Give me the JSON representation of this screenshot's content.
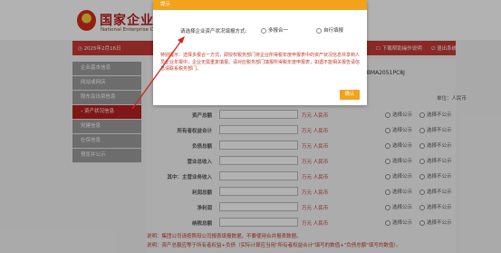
{
  "header": {
    "brand_cn": "国家企业信",
    "brand_en": "National Enterprise Cr"
  },
  "topbar": {
    "date": "2025年2月16日",
    "help": "下载帮助操作说明",
    "logout": "退出系统"
  },
  "sidebar": {
    "items": [
      {
        "label": "企业基本信息",
        "active": false
      },
      {
        "label": "网站或网店",
        "active": false
      },
      {
        "label": "股东及出资信息",
        "active": false
      },
      {
        "label": "资产状况信息",
        "active": true
      },
      {
        "label": "党建信息",
        "active": false
      },
      {
        "label": "社保信息",
        "active": false
      },
      {
        "label": "预览并公示",
        "active": false
      }
    ]
  },
  "main": {
    "reg_code": "1BMA2051PC8J",
    "unit_label": "单位：人民币",
    "unit_suffix": "万元 人民币",
    "publish_label": "选择公示",
    "nopublish_label": "选择不公示",
    "rows": [
      {
        "label": "资产总额"
      },
      {
        "label": "所有者权益合计"
      },
      {
        "label": "负债总额"
      },
      {
        "label": "营业总收入"
      },
      {
        "label": "其中：主营业务收入"
      },
      {
        "label": "利润总额"
      },
      {
        "label": "净利润"
      },
      {
        "label": "纳税总额"
      }
    ],
    "notes": [
      "说明：集团公司请按照母公司报表填报数据，不要使用合并报表数据。",
      "说明：资产总额应等于所有者权益+负债（实际计算应当用\"所有者权益合计\"填写的数值+\"负债总额\"填写的数值）。"
    ]
  },
  "dialog": {
    "title": "提示",
    "question": "请选择企业资产状况填报方式:",
    "option1": "多报合一",
    "option2": "自行填报",
    "warning": "特别提示：选择多报合一方式，即授权税务部门将企业所得税年度申报表中的资产状况信息共享到人员企业年报中，企业无需重复填报。请对应税务部门填报所得税年度申报表，如遇不能相关报告请信息请联系税务部门。",
    "confirm": "确认"
  },
  "colors": {
    "brand_red": "#b71d1d",
    "active_menu": "#b8201f",
    "dialog_orange": "#f2a21b",
    "warning_red": "#c0392b"
  }
}
